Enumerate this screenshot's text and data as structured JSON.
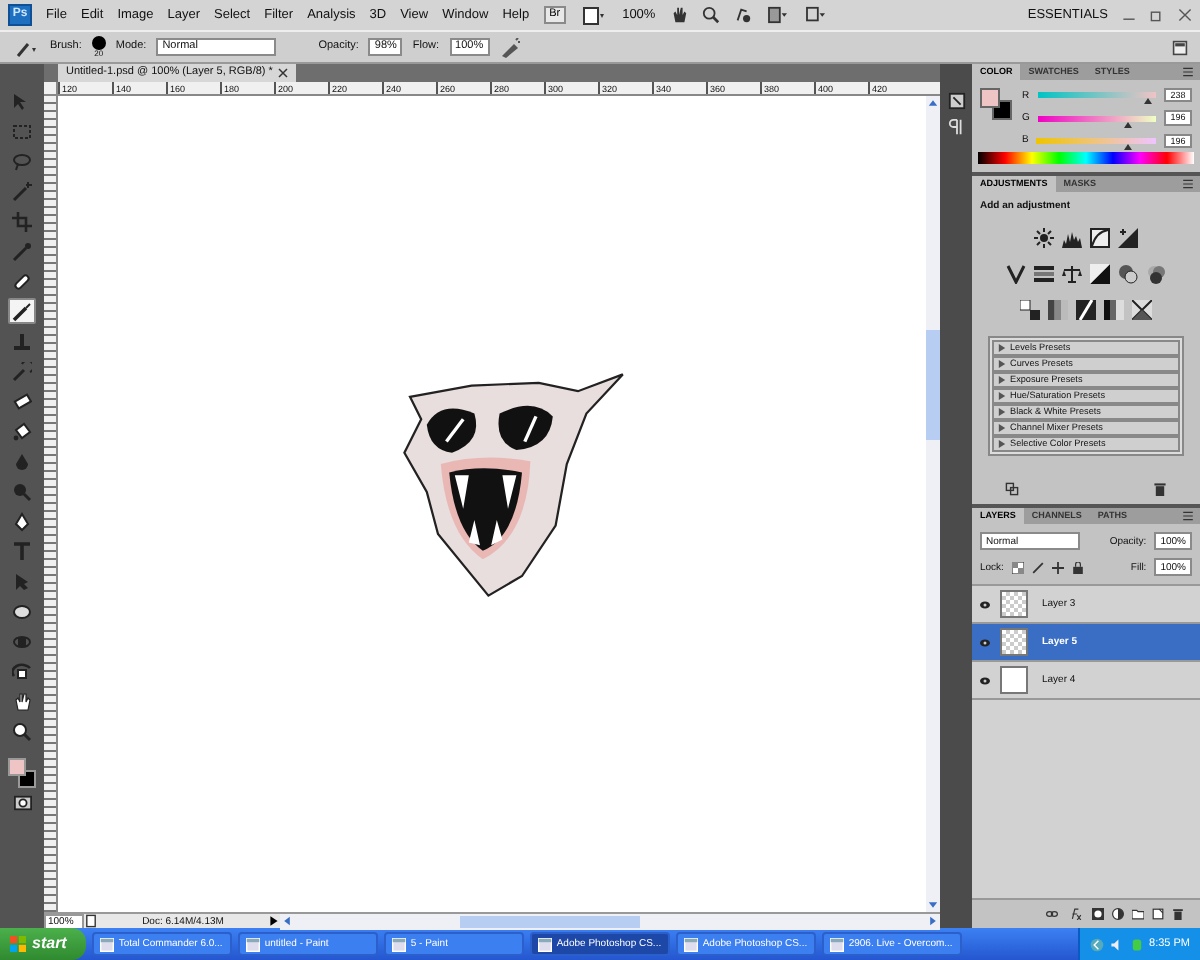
{
  "menu": [
    "File",
    "Edit",
    "Image",
    "Layer",
    "Select",
    "Filter",
    "Analysis",
    "3D",
    "View",
    "Window",
    "Help"
  ],
  "app_bar": {
    "logo": "Ps",
    "bridge_button": "Br",
    "zoom": "100%",
    "workspace": "ESSENTIALS"
  },
  "options_bar": {
    "brush_label": "Brush:",
    "brush_size": "20",
    "mode_label": "Mode:",
    "mode": "Normal",
    "opacity_label": "Opacity:",
    "opacity": "98%",
    "flow_label": "Flow:",
    "flow": "100%"
  },
  "tools": [
    {
      "kind": "move",
      "selected": false
    },
    {
      "kind": "marquee",
      "selected": false
    },
    {
      "kind": "lasso",
      "selected": false
    },
    {
      "kind": "wand",
      "selected": false
    },
    {
      "kind": "crop",
      "selected": false
    },
    {
      "kind": "eyedropper",
      "selected": false
    },
    {
      "kind": "healing",
      "selected": false
    },
    {
      "kind": "brush",
      "selected": true
    },
    {
      "kind": "stamp",
      "selected": false
    },
    {
      "kind": "history",
      "selected": false
    },
    {
      "kind": "eraser",
      "selected": false
    },
    {
      "kind": "bucket",
      "selected": false
    },
    {
      "kind": "blur",
      "selected": false
    },
    {
      "kind": "dodge",
      "selected": false
    },
    {
      "kind": "pen",
      "selected": false
    },
    {
      "kind": "type",
      "selected": false
    },
    {
      "kind": "select",
      "selected": false
    },
    {
      "kind": "shape",
      "selected": false
    },
    {
      "kind": "rotate3d",
      "selected": false
    },
    {
      "kind": "orbit3d",
      "selected": false
    },
    {
      "kind": "hand",
      "selected": false
    },
    {
      "kind": "zoom",
      "selected": false
    }
  ],
  "document": {
    "tab_title": "Untitled-1.psd @ 100% (Layer 5, RGB/8) *",
    "ruler_labels": [
      "120",
      "140",
      "160",
      "180",
      "200",
      "220",
      "240",
      "260",
      "280",
      "300",
      "320",
      "340",
      "360",
      "380",
      "400",
      "420"
    ],
    "zoom": "100%",
    "doc_info": "Doc: 6.14M/4.13M"
  },
  "color_panel": {
    "tabs": [
      {
        "label": "COLOR",
        "selected": true
      },
      {
        "label": "SWATCHES",
        "selected": false
      },
      {
        "label": "STYLES",
        "selected": false
      }
    ],
    "channels": [
      {
        "name": "R",
        "value": "238",
        "level": 0.93
      },
      {
        "name": "G",
        "value": "196",
        "level": 0.77
      },
      {
        "name": "B",
        "value": "196",
        "level": 0.77
      }
    ]
  },
  "adjustments_panel": {
    "tabs": [
      {
        "label": "ADJUSTMENTS",
        "selected": true
      },
      {
        "label": "MASKS",
        "selected": false
      }
    ],
    "heading": "Add an adjustment",
    "icon_rows": [
      [
        {
          "kind": "brightness"
        },
        {
          "kind": "levels"
        },
        {
          "kind": "curves"
        },
        {
          "kind": "exposure"
        }
      ],
      [
        {
          "kind": "vibrance"
        },
        {
          "kind": "hue"
        },
        {
          "kind": "balance"
        },
        {
          "kind": "bw"
        },
        {
          "kind": "filter"
        },
        {
          "kind": "mixer"
        }
      ],
      [
        {
          "kind": "invert"
        },
        {
          "kind": "posterize"
        },
        {
          "kind": "threshold"
        },
        {
          "kind": "gradient"
        },
        {
          "kind": "selective"
        }
      ]
    ],
    "presets": [
      "Levels Presets",
      "Curves Presets",
      "Exposure Presets",
      "Hue/Saturation Presets",
      "Black & White Presets",
      "Channel Mixer Presets",
      "Selective Color Presets"
    ]
  },
  "layers_panel": {
    "tabs": [
      {
        "label": "LAYERS",
        "selected": true
      },
      {
        "label": "CHANNELS",
        "selected": false
      },
      {
        "label": "PATHS",
        "selected": false
      }
    ],
    "blend_mode": "Normal",
    "opacity_label": "Opacity:",
    "opacity": "100%",
    "lock_label": "Lock:",
    "fill_label": "Fill:",
    "fill": "100%",
    "layers": [
      {
        "name": "Layer 3",
        "visible": true,
        "selected": false,
        "kind": "transparent"
      },
      {
        "name": "Layer 5",
        "visible": true,
        "selected": true,
        "kind": "transparent"
      },
      {
        "name": "Layer 4",
        "visible": true,
        "selected": false,
        "kind": "filled"
      }
    ]
  },
  "taskbar": {
    "start": "start",
    "tasks": [
      {
        "label": "Total Commander 6.0...",
        "selected": false
      },
      {
        "label": "untitled - Paint",
        "selected": false
      },
      {
        "label": "5 - Paint",
        "selected": false
      },
      {
        "label": "Adobe Photoshop CS...",
        "selected": true
      },
      {
        "label": "Adobe Photoshop CS...",
        "selected": false
      },
      {
        "label": "2906. Live - Overcom...",
        "selected": false
      }
    ],
    "clock": "8:35 PM"
  }
}
